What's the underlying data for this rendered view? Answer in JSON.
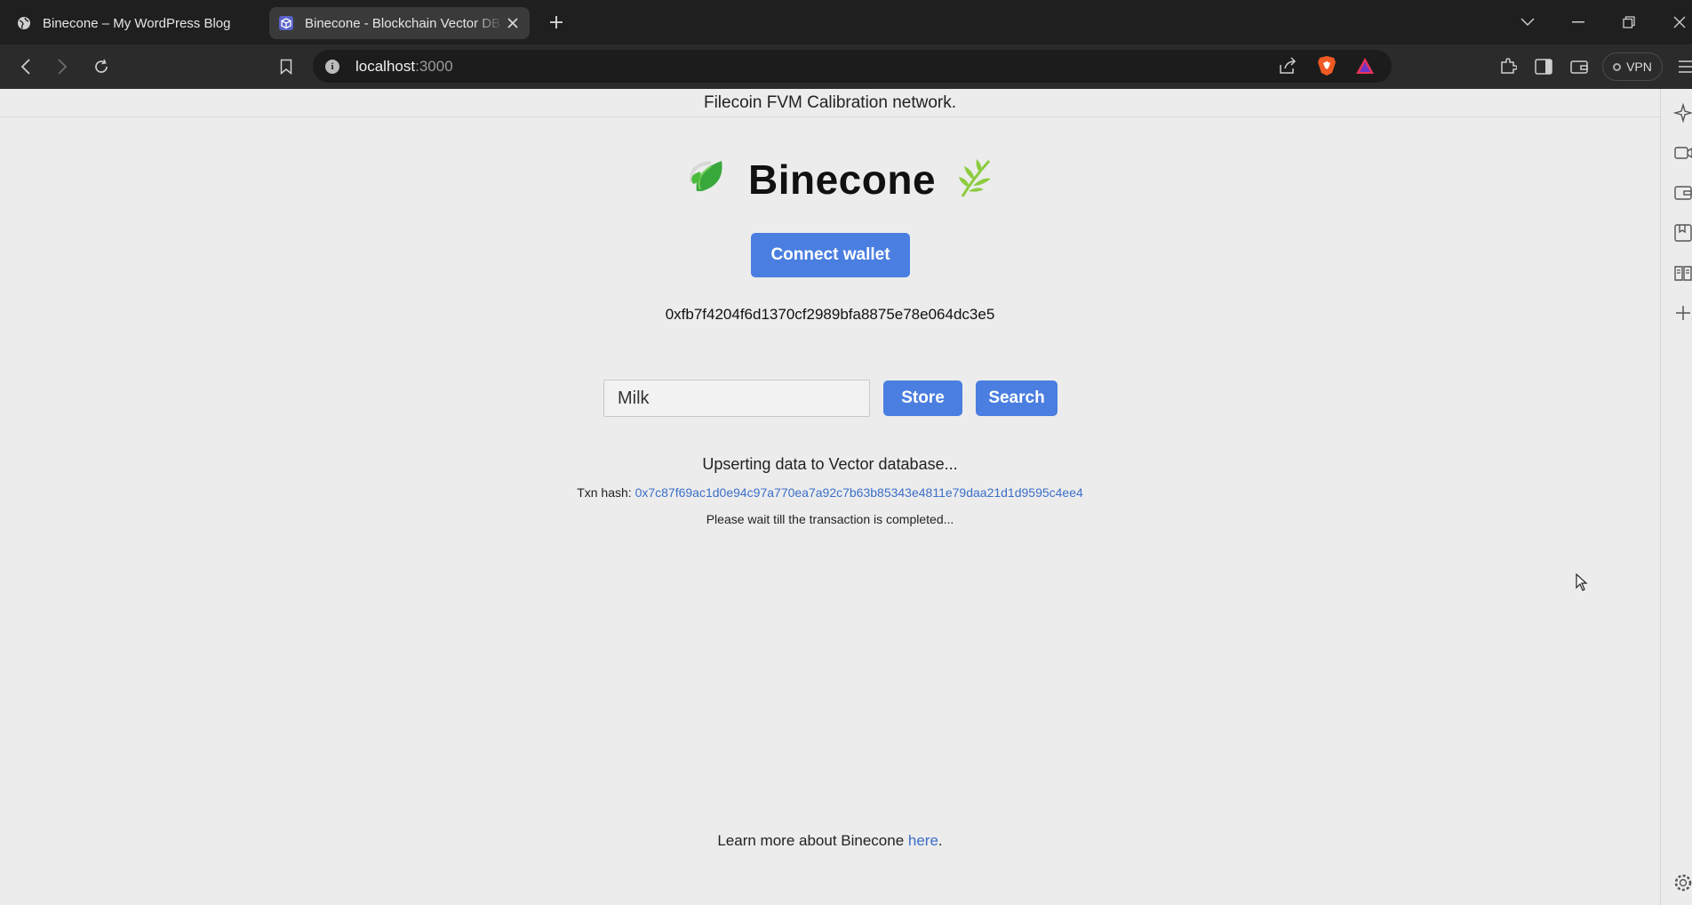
{
  "browser": {
    "tabs": [
      {
        "title": "Binecone – My WordPress Blog",
        "active": false
      },
      {
        "title": "Binecone - Blockchain Vector DB",
        "active": true
      }
    ],
    "url_host": "localhost",
    "url_port": ":3000",
    "vpn_label": "VPN"
  },
  "page": {
    "network": "Filecoin FVM Calibration network.",
    "title": "Binecone",
    "connect_label": "Connect wallet",
    "wallet_address": "0xfb7f4204f6d1370cf2989bfa8875e78e064dc3e5",
    "input_value": "Milk",
    "store_label": "Store",
    "search_label": "Search",
    "status": "Upserting data to Vector database...",
    "txn_label": "Txn hash: ",
    "txn_hash": "0x7c87f69ac1d0e94c97a770ea7a92c7b63b85343e4811e79daa21d1d9595c4ee4",
    "wait_msg": "Please wait till the transaction is completed...",
    "footer_prefix": "Learn more about Binecone ",
    "footer_link": "here",
    "footer_suffix": "."
  },
  "colors": {
    "accent": "#4a7ee0",
    "link": "#3b6fc9"
  }
}
